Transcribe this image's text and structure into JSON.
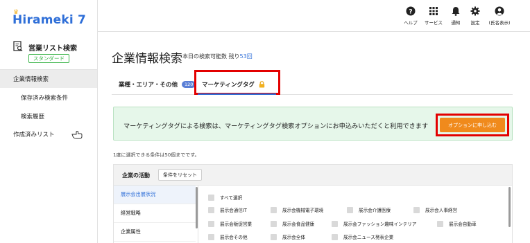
{
  "app": {
    "logo_text": "Hirameki 7"
  },
  "sidebar": {
    "title": "営業リスト検索",
    "plan_badge": "スタンダード",
    "items": [
      {
        "label": "企業情報検索",
        "active": true
      },
      {
        "label": "保存済み検索条件",
        "active": false
      },
      {
        "label": "検索履歴",
        "active": false
      },
      {
        "label": "作成済みリスト",
        "active": false
      }
    ]
  },
  "topbar": {
    "help": "ヘルプ",
    "services": "サービス",
    "notifications": "通知",
    "settings": "設定",
    "user": "(氏名表示)"
  },
  "main": {
    "title": "企業情報検索",
    "search_count_prefix": "本日の検索可能数 残り",
    "search_count_value": "53",
    "search_count_suffix": "回",
    "tabs": [
      {
        "label": "業種・エリア・その他",
        "badge": "120"
      },
      {
        "label": "マーケティングタグ",
        "locked": true
      }
    ],
    "notice_text": "マーケティングタグによる検索は、マーケティングタグ検索オプションにお申込みいただくと利用できます",
    "apply_button": "オプションに申し込む",
    "limit_note": "1度に選択できる条件は50個までです。",
    "panel": {
      "head_label": "企業の活動",
      "reset_button": "条件をリセット",
      "categories": [
        "展示会出展状況",
        "経営戦略",
        "企業属性"
      ],
      "options": {
        "select_all": "すべて選択",
        "row1": [
          "展示会通信IT",
          "展示会機械電子環境",
          "展示会介護医療",
          "展示会人事経営"
        ],
        "row2": [
          "展示会販促営業",
          "展示会食品健康",
          "展示会ファッション趣味インテリア",
          "展示会自動車"
        ],
        "row3": [
          "展示会その他",
          "展示会全体",
          "展示会ニュース発表企業"
        ]
      }
    }
  },
  "colors": {
    "accent": "#2f6fd8",
    "highlight_border": "#e30000",
    "apply_button": "#f08a1c",
    "notice_bg": "#e6f7ea",
    "plan_badge": "#3bb54a"
  }
}
